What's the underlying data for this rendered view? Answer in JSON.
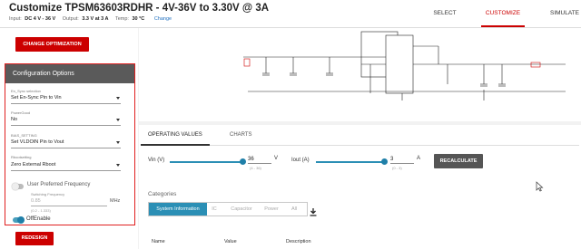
{
  "header": {
    "title": "Customize TPSM63603RDHR -  4V-36V to 3.30V @ 3A",
    "input_label": "Input:",
    "input_value": "DC 4 V - 36 V",
    "output_label": "Output:",
    "output_value": "3.3 V at 3 A",
    "temp_label": "Temp:",
    "temp_value": "30 °C",
    "change_link": "Change"
  },
  "nav": {
    "select": "SELECT",
    "customize": "CUSTOMIZE",
    "simulate": "SIMULATE"
  },
  "left": {
    "change_optimization": "CHANGE OPTIMIZATION",
    "config_title": "Configuration Options",
    "fields": [
      {
        "label": "En_Sync selection",
        "value": "Set En-Sync Pin to Vin"
      },
      {
        "label": "PowerGood",
        "value": "No"
      },
      {
        "label": "BIAS_SETTING",
        "value": "Set VLDOIN Pin to Vout"
      },
      {
        "label": "Rbootsetting",
        "value": "Zero External Rboot"
      }
    ],
    "user_pref_freq": "User Preferred Frequency",
    "switching_freq_label": "Switching Frequency",
    "switching_freq_value": "0.85",
    "switching_freq_unit": "MHz",
    "switching_freq_range": "(0.2 - 1.333)",
    "off_enable": "OffEnable",
    "redesign": "REDESIGN"
  },
  "values": {
    "tab_operating": "OPERATING VALUES",
    "tab_charts": "CHARTS",
    "vin_label": "Vin (V)",
    "vin_value": "36",
    "vin_unit": "V",
    "vin_range": "(4 - 36)",
    "vin_fraction": 1.0,
    "iout_label": "Iout (A)",
    "iout_value": "3",
    "iout_unit": "A",
    "iout_range": "(0 - 3)",
    "iout_fraction": 1.0,
    "recalculate": "RECALCULATE",
    "categories_label": "Categories",
    "categories": [
      "System Information",
      "IC",
      "Capacitor",
      "Power",
      "All"
    ],
    "table_headers": [
      "Name",
      "Value",
      "Description"
    ]
  },
  "colors": {
    "accent_red": "#cc0000",
    "accent_blue": "#2b8fb5"
  }
}
